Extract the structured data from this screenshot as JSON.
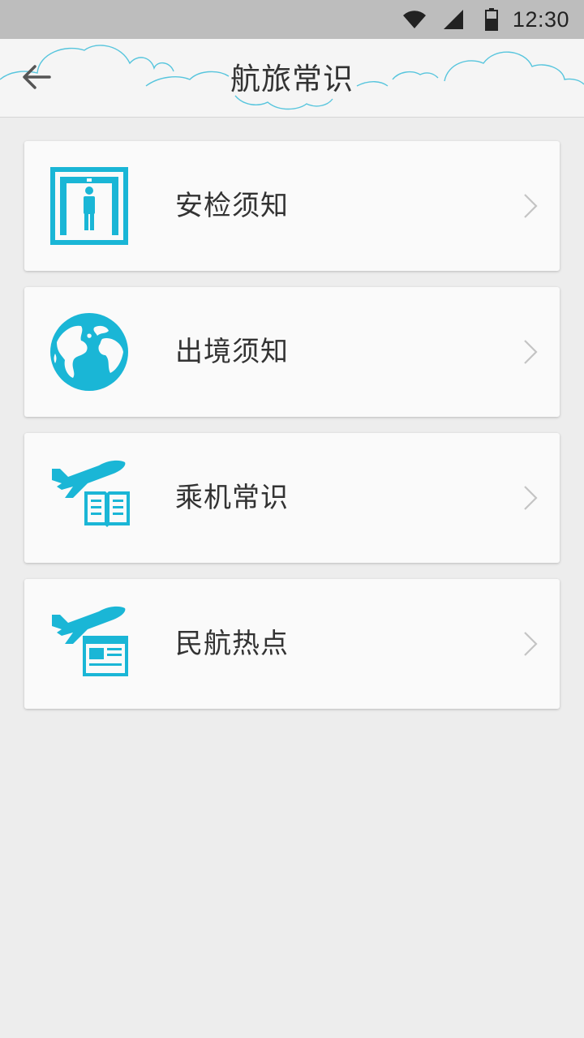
{
  "status_bar": {
    "time": "12:30",
    "icons": [
      "wifi-icon",
      "signal-icon",
      "battery-icon"
    ]
  },
  "header": {
    "title": "航旅常识",
    "back_icon": "arrow-left-icon"
  },
  "colors": {
    "accent": "#1ab6d6",
    "cloud_outline": "#57c5dd",
    "status_bar": "#bdbdbd",
    "background": "#ededed",
    "card": "#fafafa",
    "text": "#333333",
    "chevron": "#c4c4c4"
  },
  "menu": {
    "items": [
      {
        "label": "安检须知",
        "icon": "security-gate-icon"
      },
      {
        "label": "出境须知",
        "icon": "globe-icon"
      },
      {
        "label": "乘机常识",
        "icon": "plane-book-icon"
      },
      {
        "label": "民航热点",
        "icon": "plane-news-icon"
      }
    ]
  }
}
